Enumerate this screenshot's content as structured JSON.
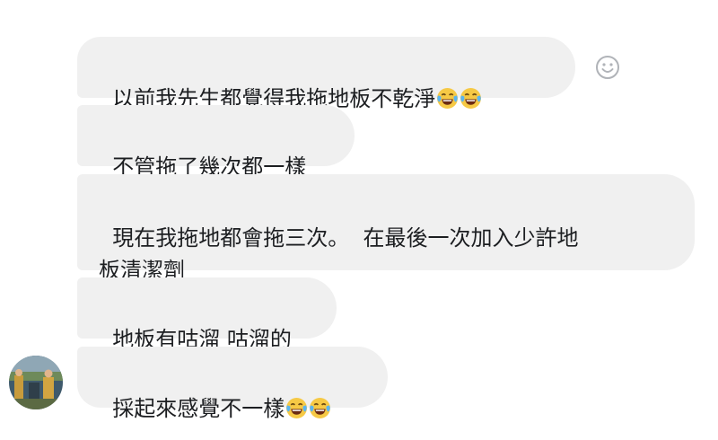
{
  "chat": {
    "messages": [
      {
        "text": "以前我先生都覺得我拖地板不乾淨",
        "emojis": [
          "face-with-tears-of-joy-icon",
          "face-with-tears-of-joy-icon"
        ]
      },
      {
        "text": "不管拖了幾次都一樣",
        "emojis": []
      },
      {
        "text": "現在我拖地都會拖三次。  在最後一次加入少許地\n板清潔劑",
        "emojis": []
      },
      {
        "text": "地板有咕溜 咕溜的",
        "emojis": []
      },
      {
        "text": "採起來感覺不一樣",
        "emojis": [
          "face-with-tears-of-joy-icon",
          "face-with-tears-of-joy-icon"
        ]
      }
    ],
    "reaction_button_icon": "smiley-icon",
    "sender_avatar_icon": "avatar",
    "colors": {
      "bubble_background": "#f0f0f0",
      "text": "#1c1e21",
      "reaction_icon": "#b0b3b8",
      "emoji_face": "#f6c945"
    }
  }
}
